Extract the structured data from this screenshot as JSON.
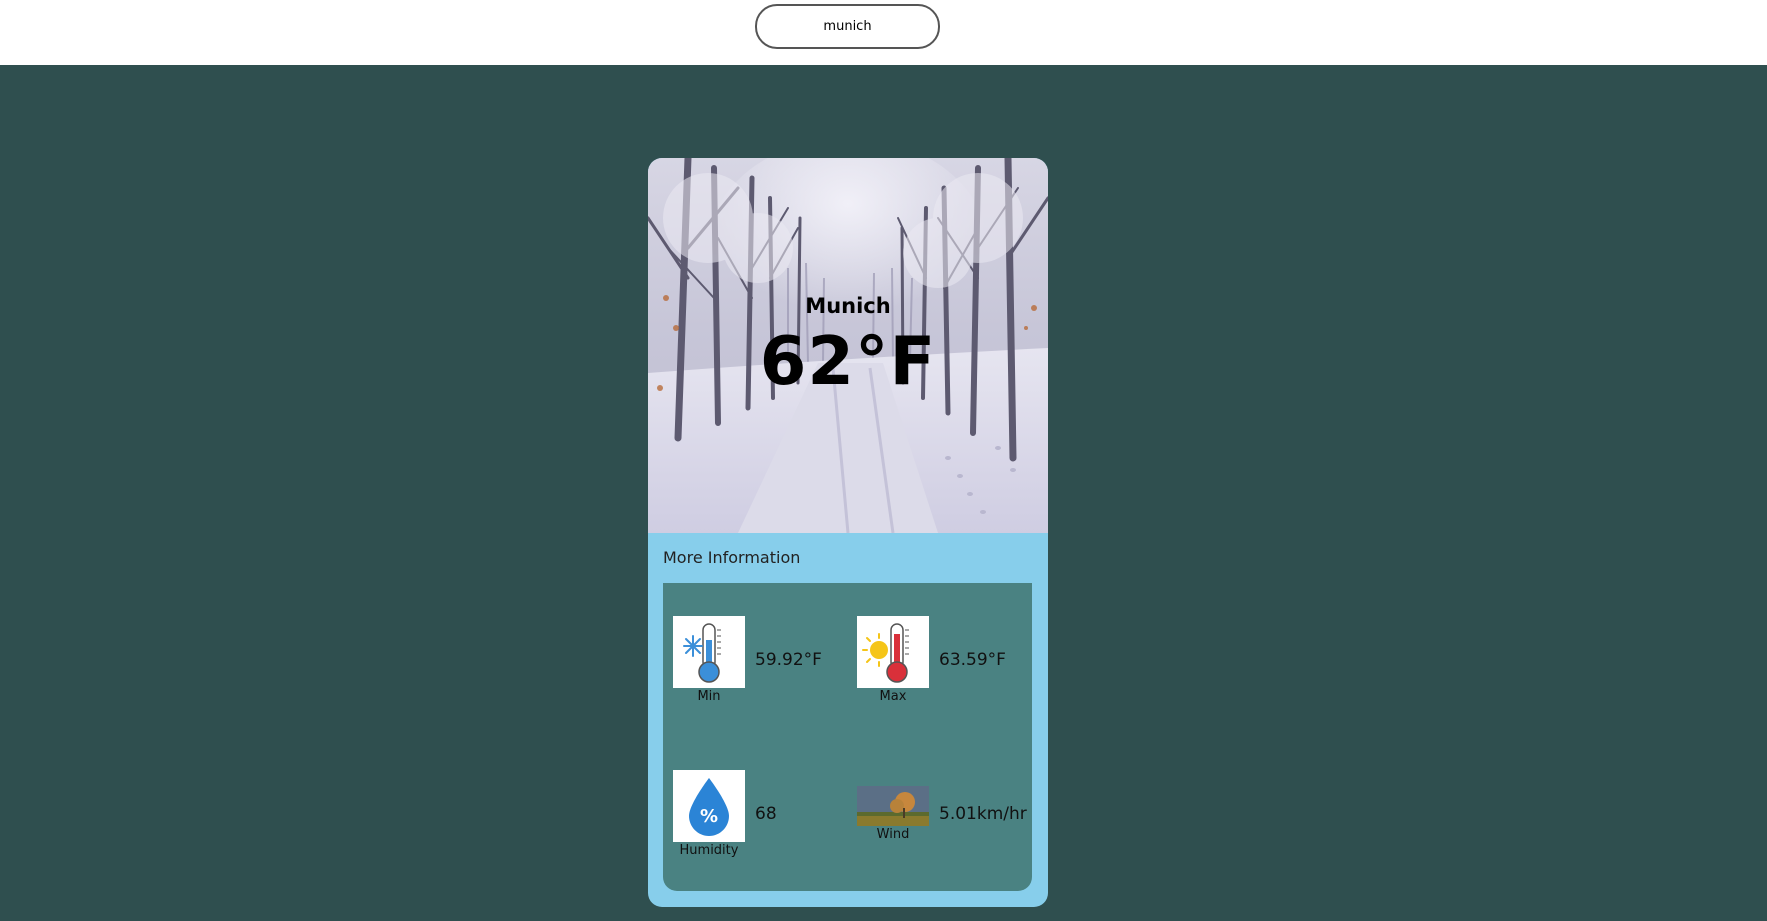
{
  "search": {
    "value": "munich"
  },
  "weather": {
    "city": "Munich",
    "temperature": "62°F"
  },
  "details": {
    "title": "More Information",
    "min": {
      "label": "Min",
      "value": "59.92°F",
      "icon": "cold-thermometer-icon"
    },
    "max": {
      "label": "Max",
      "value": "63.59°F",
      "icon": "hot-thermometer-icon"
    },
    "humidity": {
      "label": "Humidity",
      "value": "68",
      "icon": "humidity-drop-icon"
    },
    "wind": {
      "label": "Wind",
      "value": "5.01km/hr",
      "icon": "wind-landscape-icon"
    }
  },
  "colors": {
    "page_background": "#2f4f4f",
    "card_background": "#87ceeb",
    "panel_background": "#4a8282"
  }
}
